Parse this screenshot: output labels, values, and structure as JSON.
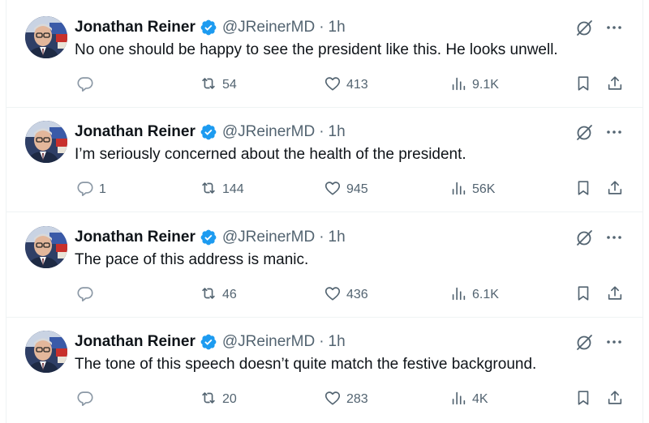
{
  "tweets": [
    {
      "name": "Jonathan Reiner",
      "handle": "@JReinerMD",
      "separator": "·",
      "time": "1h",
      "text": "No one should be happy to see the president like this. He looks unwell.",
      "replies": "",
      "retweets": "54",
      "likes": "413",
      "views": "9.1K"
    },
    {
      "name": "Jonathan Reiner",
      "handle": "@JReinerMD",
      "separator": "·",
      "time": "1h",
      "text": "I’m seriously concerned about the health of the president.",
      "replies": "1",
      "retweets": "144",
      "likes": "945",
      "views": "56K"
    },
    {
      "name": "Jonathan Reiner",
      "handle": "@JReinerMD",
      "separator": "·",
      "time": "1h",
      "text": "The pace of this address is manic.",
      "replies": "",
      "retweets": "46",
      "likes": "436",
      "views": "6.1K"
    },
    {
      "name": "Jonathan Reiner",
      "handle": "@JReinerMD",
      "separator": "·",
      "time": "1h",
      "text": "The tone of this speech doesn’t quite match the festive background.",
      "replies": "",
      "retweets": "20",
      "likes": "283",
      "views": "4K"
    }
  ],
  "icons": {
    "reply": "reply-icon",
    "retweet": "retweet-icon",
    "like": "heart-icon",
    "views": "views-icon",
    "bookmark": "bookmark-icon",
    "share": "share-icon",
    "grok": "grok-icon",
    "more": "more-icon",
    "verified": "verified-badge-icon"
  },
  "colors": {
    "text": "#0f1419",
    "secondary": "#536471",
    "verified": "#1d9bf0",
    "divider": "#eff3f4"
  }
}
